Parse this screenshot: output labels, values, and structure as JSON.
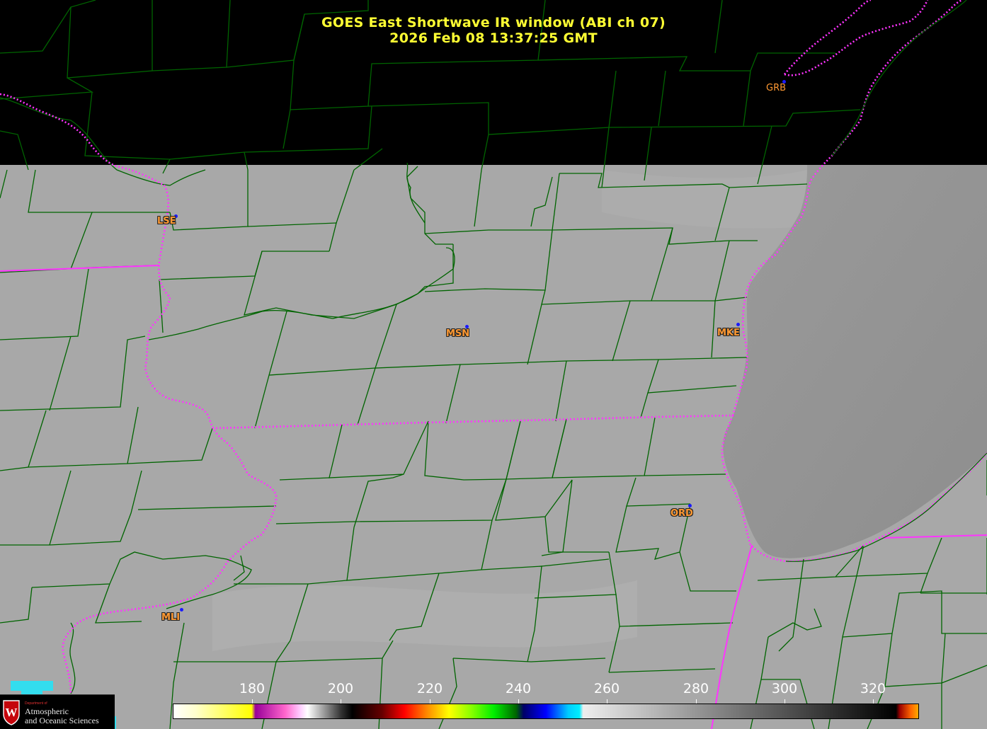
{
  "title": {
    "line1": "GOES East Shortwave IR window (ABI ch 07)",
    "line2": "2026 Feb 08  13:37:25 GMT"
  },
  "stations": [
    {
      "id": "GRB",
      "label": "GRB"
    },
    {
      "id": "LSE",
      "label": "LSE"
    },
    {
      "id": "MSN",
      "label": "MSN"
    },
    {
      "id": "MKE",
      "label": "MKE"
    },
    {
      "id": "ORD",
      "label": "ORD"
    },
    {
      "id": "MLI",
      "label": "MLI"
    }
  ],
  "colorbar": {
    "ticks": [
      "180",
      "200",
      "220",
      "240",
      "260",
      "280",
      "300",
      "320"
    ],
    "tick_values": [
      180,
      200,
      220,
      240,
      260,
      280,
      300,
      320
    ],
    "range": [
      162,
      330
    ]
  },
  "logo": {
    "small": "Department of",
    "line1": "Atmospheric",
    "line2": "and Oceanic Sciences",
    "shield_letter": "W"
  },
  "colors": {
    "title": "#ffff33",
    "county_lines": "#006400",
    "state_lines": "#ff33ff",
    "station_label": "#ff9933",
    "station_dot": "#1a1aff",
    "background": "#000000",
    "imagery_gray": "#a6a6a6"
  }
}
